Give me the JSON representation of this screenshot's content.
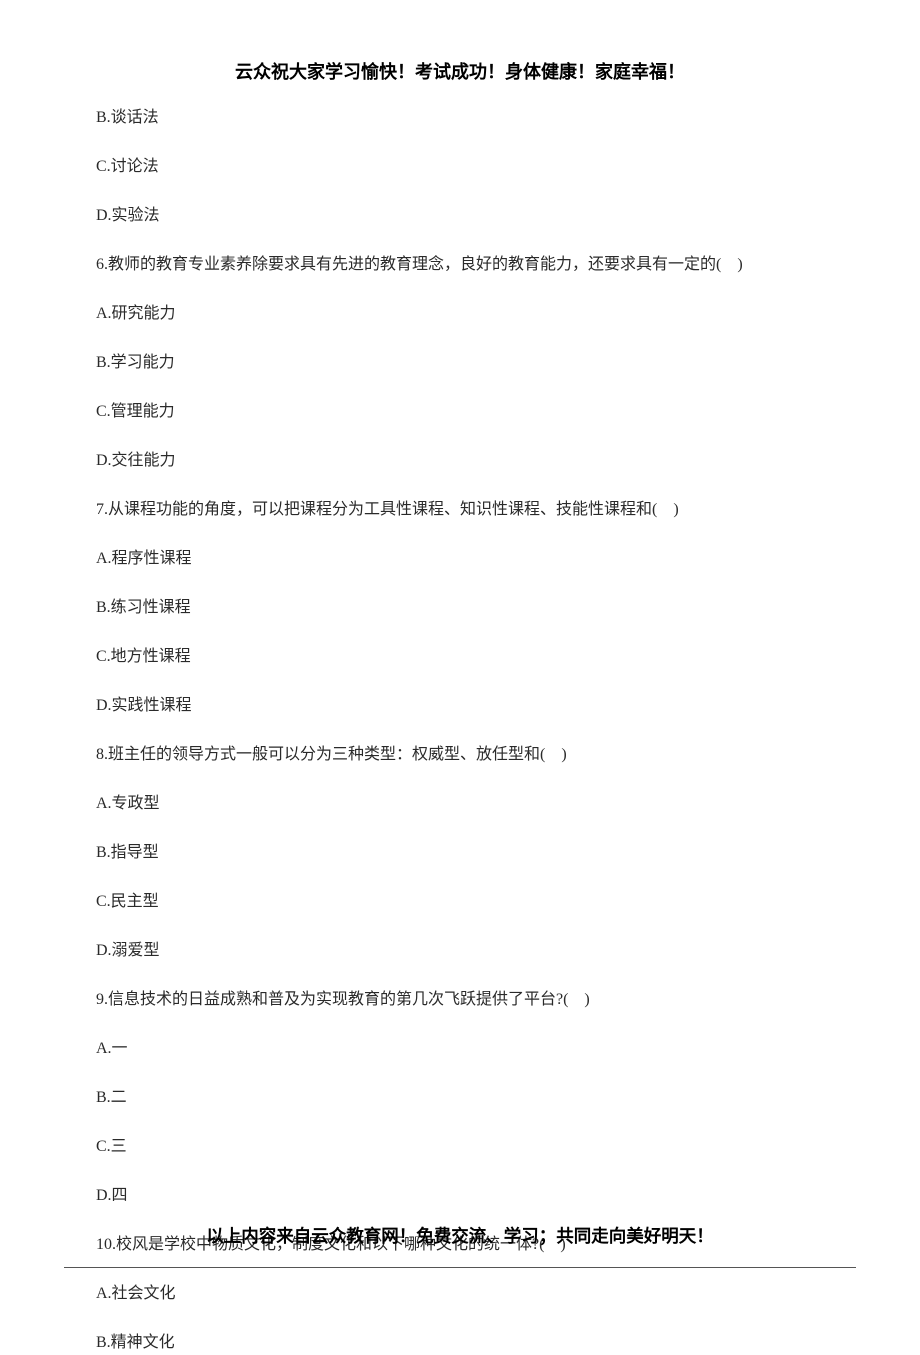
{
  "header": "云众祝大家学习愉快！考试成功！身体健康！家庭幸福！",
  "footer": "以上内容来自云众教育网！免费交流、学习；共同走向美好明天！",
  "lines": [
    "B.谈话法",
    "C.讨论法",
    "D.实验法",
    "6.教师的教育专业素养除要求具有先进的教育理念，良好的教育能力，还要求具有一定的(　)",
    "A.研究能力",
    "B.学习能力",
    "C.管理能力",
    "D.交往能力",
    "7.从课程功能的角度，可以把课程分为工具性课程、知识性课程、技能性课程和(　)",
    "A.程序性课程",
    "B.练习性课程",
    "C.地方性课程",
    "D.实践性课程",
    "8.班主任的领导方式一般可以分为三种类型：权威型、放任型和(　)",
    "A.专政型",
    "B.指导型",
    "C.民主型",
    "D.溺爱型",
    "9.信息技术的日益成熟和普及为实现教育的第几次飞跃提供了平台?(　)",
    "A.一",
    "B.二",
    "C.三",
    "D.四",
    "10.校风是学校中物质文化，制度文化和以下哪种文化的统一体?(　)",
    "A.社会文化",
    "B.精神文化"
  ]
}
